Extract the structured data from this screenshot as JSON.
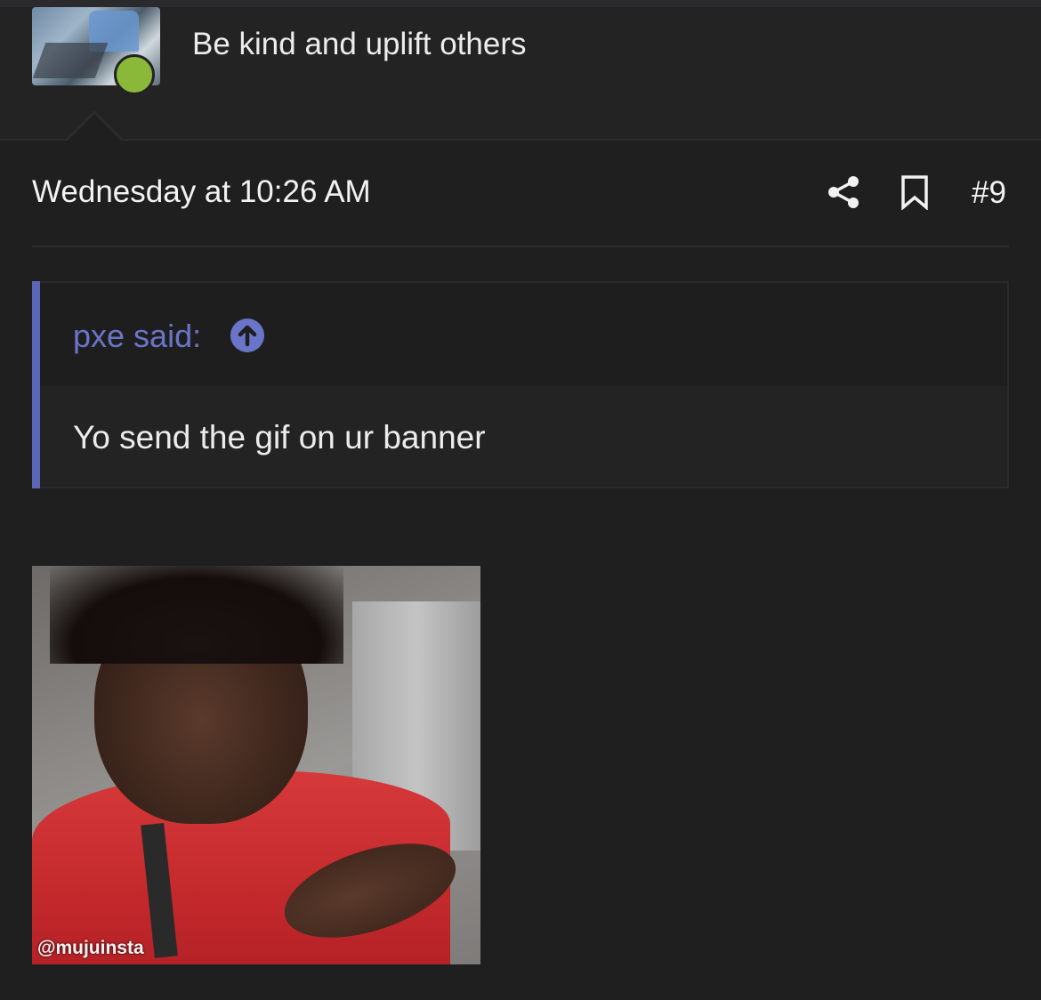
{
  "user": {
    "title": "Be kind and uplift others",
    "status": "online"
  },
  "post": {
    "date": "Wednesday at 10:26 AM",
    "number": "#9",
    "actions": {
      "share_icon": "share-icon",
      "bookmark_icon": "bookmark-icon"
    },
    "quote": {
      "author_line": "pxe said:",
      "jump_icon": "arrow-up-circle-icon",
      "text": "Yo send the gif on ur banner"
    },
    "attachment": {
      "watermark": "@mujuinsta"
    }
  },
  "colors": {
    "background": "#1f1f20",
    "quote_accent": "#5b67b6",
    "online": "#8ab93a"
  }
}
